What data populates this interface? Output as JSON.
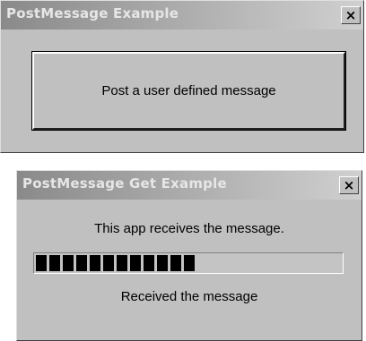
{
  "window1": {
    "title": "PostMessage Example",
    "close_glyph": "×",
    "button_label": "Post a user defined message"
  },
  "window2": {
    "title": "PostMessage Get Example",
    "close_glyph": "×",
    "message_text": "This app receives the message.",
    "progress_fraction": 0.55,
    "status_text": "Received the message"
  },
  "icons": {
    "close": "close-icon"
  }
}
